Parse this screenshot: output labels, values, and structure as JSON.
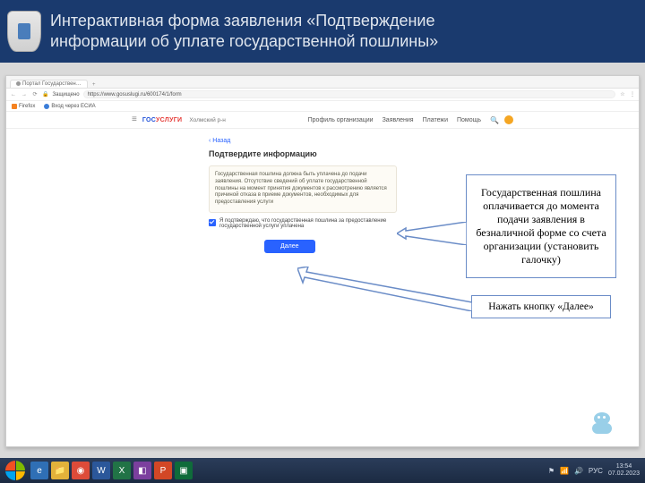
{
  "slide": {
    "title_line1": "Интерактивная форма заявления «Подтверждение",
    "title_line2": "информации об уплате государственной пошлины»"
  },
  "browser": {
    "tab_title": "Портал Государствен…",
    "tab_new": "+",
    "secure_label": "Защищено",
    "url": "https://www.gosuslugi.ru/600174/1/form",
    "bookmarks": {
      "firefox": "Firefox",
      "vhod": "Вход через ЕСИА"
    }
  },
  "portal": {
    "logo_gos": "ГОС",
    "logo_uslugi": "УСЛУГИ",
    "region": "Холмский р-н",
    "nav": {
      "profile": "Профиль организации",
      "zayav": "Заявления",
      "platezhi": "Платежи",
      "pomosh": "Помощь"
    },
    "back": "‹ Назад",
    "heading": "Подтвердите информацию",
    "notice": "Государственная пошлина должна быть уплачена до подачи заявления. Отсутствие сведений об уплате государственной пошлины на момент принятия документов к рассмотрению является причиной отказа в приеме документов, необходимых для предоставления услуги",
    "checkbox_label": "Я подтверждаю, что государственная пошлина за предоставление государственной услуги уплачена",
    "next_button": "Далее"
  },
  "callouts": {
    "c1": "Государственная пошлина оплачивается до момента подачи заявления в безналичной форме со счета организации (установить галочку)",
    "c2": "Нажать кнопку «Далее»"
  },
  "taskbar": {
    "lang": "РУС",
    "time": "13:54",
    "date": "07.02.2023"
  }
}
